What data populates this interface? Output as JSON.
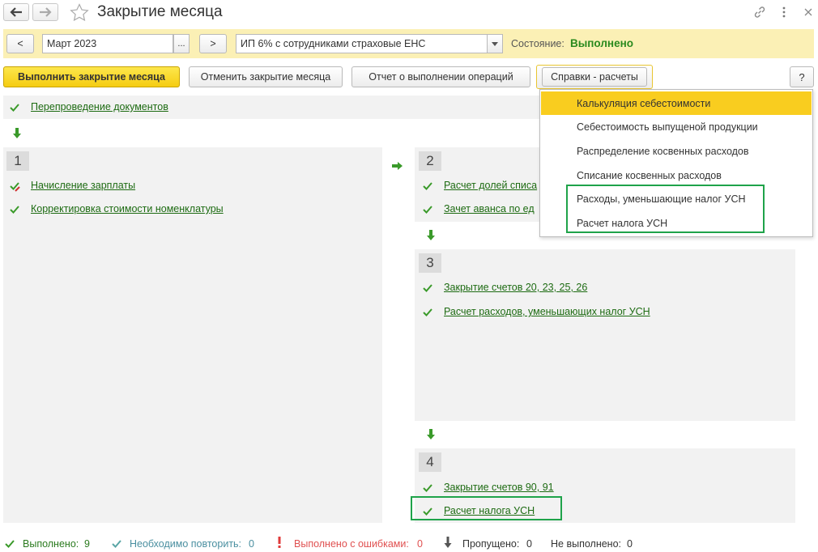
{
  "window": {
    "title": "Закрытие месяца",
    "icons": [
      "back-arrow-icon",
      "forward-arrow-icon",
      "star-icon",
      "link-icon",
      "more-icon",
      "close-icon"
    ]
  },
  "period": {
    "prev_label": "<",
    "month_value": "Март 2023",
    "choose_label": "...",
    "next_label": ">",
    "organization_value": "ИП 6% с сотрудниками страховые ЕНС",
    "status_label": "Состояние:",
    "status_value": "Выполнено"
  },
  "toolbar": {
    "run_label": "Выполнить закрытие месяца",
    "cancel_label": "Отменить закрытие месяца",
    "report_label": "Отчет о выполнении операций",
    "reports_label": "Справки - расчеты",
    "help_label": "?"
  },
  "reposting": {
    "label": "Перепроведение документов"
  },
  "sections": [
    {
      "number": "1",
      "items": [
        "Начисление зарплаты",
        "Корректировка стоимости номенклатуры"
      ]
    },
    {
      "number": "2",
      "items": [
        "Расчет долей списа",
        "Зачет аванса по ед"
      ]
    },
    {
      "number": "3",
      "items": [
        "Закрытие счетов 20, 23, 25, 26",
        "Расчет расходов, уменьшающих налог УСН"
      ]
    },
    {
      "number": "4",
      "items": [
        "Закрытие счетов 90, 91",
        "Расчет налога УСН"
      ]
    }
  ],
  "dropdown": {
    "items": [
      "Калькуляция себестоимости",
      "Себестоимость выпущеной продукции",
      "Распределение косвенных расходов",
      "Списание косвенных расходов",
      "Расходы, уменьшающие налог УСН",
      "Расчет налога УСН"
    ],
    "selected_index": 0
  },
  "statusbar": {
    "done_label": "Выполнено:",
    "done_count": "9",
    "repeat_label": "Необходимо повторить:",
    "repeat_count": "0",
    "errors_label": "Выполнено с ошибками:",
    "errors_count": "0",
    "skipped_label": "Пропущено:",
    "skipped_count": "0",
    "notdone_label": "Не выполнено:",
    "notdone_count": "0"
  },
  "colors": {
    "accent_yellow": "#f9cd1f",
    "period_bar": "#fbf0b5",
    "done_green": "#2a8a1e",
    "link_green": "#1d6b12",
    "highlight_green": "#1fa34a",
    "error_red": "#e05050",
    "repeat_teal": "#4a8fa0"
  }
}
